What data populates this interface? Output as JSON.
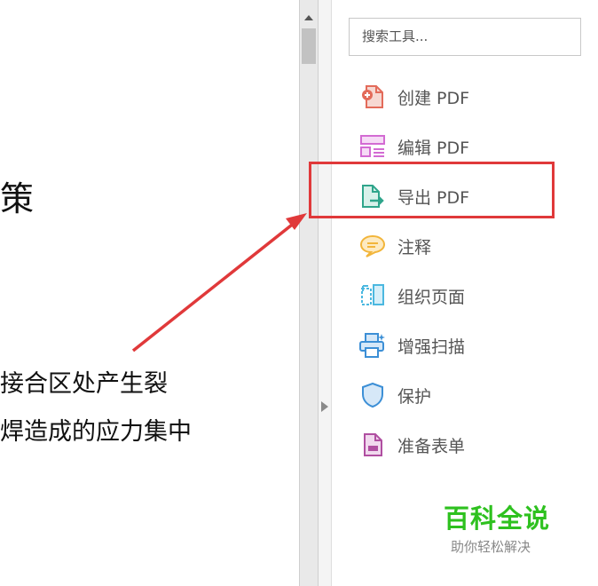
{
  "document": {
    "heading_fragment": "策",
    "line1": "接合区处产生裂",
    "line2": "焊造成的应力集中"
  },
  "search": {
    "placeholder": "搜索工具..."
  },
  "tools": [
    {
      "label": "创建 PDF",
      "icon": "create-pdf-icon",
      "color": "#e36b5a"
    },
    {
      "label": "编辑 PDF",
      "icon": "edit-pdf-icon",
      "color": "#d36bd3"
    },
    {
      "label": "导出 PDF",
      "icon": "export-pdf-icon",
      "color": "#2fa58b"
    },
    {
      "label": "注释",
      "icon": "comment-icon",
      "color": "#f2b53a"
    },
    {
      "label": "组织页面",
      "icon": "organize-pages-icon",
      "color": "#4bb8e0"
    },
    {
      "label": "增强扫描",
      "icon": "enhance-scan-icon",
      "color": "#3c8fd6"
    },
    {
      "label": "保护",
      "icon": "shield-icon",
      "color": "#3c8fd6"
    },
    {
      "label": "准备表单",
      "icon": "prepare-form-icon",
      "color": "#b04fa1"
    }
  ],
  "watermark": {
    "title": "百科全说",
    "subtitle": "助你轻松解决"
  },
  "colors": {
    "annotation": "#e0393a",
    "watermark": "#2ec11f"
  }
}
